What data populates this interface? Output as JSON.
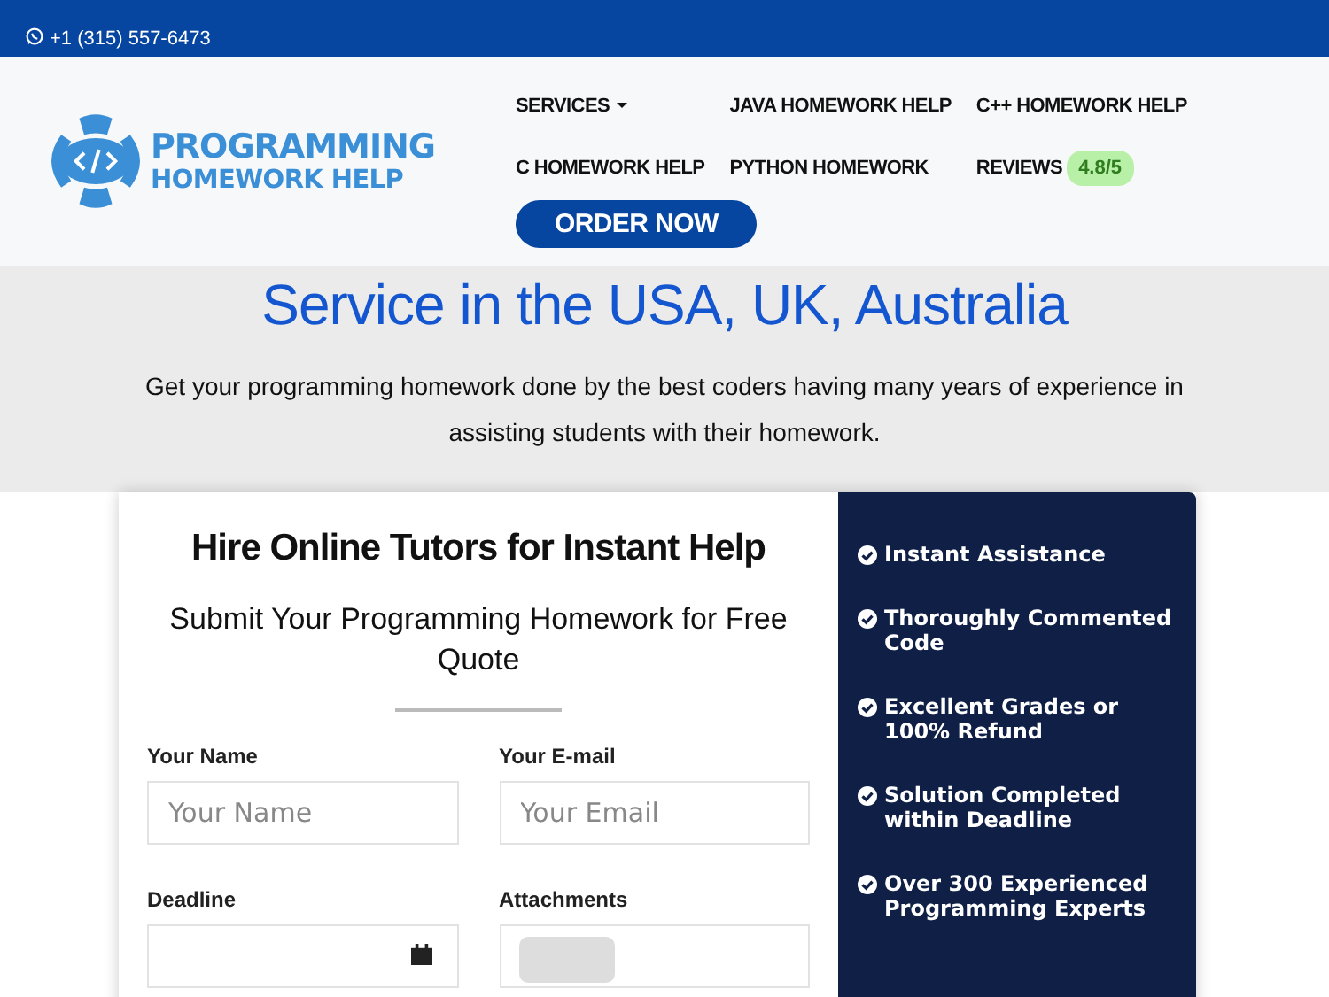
{
  "top_bar": {
    "phone": "+1 (315) 557-6473"
  },
  "logo": {
    "line_1": "PROGRAMMING",
    "line_2": "HOMEWORK HELP"
  },
  "nav": {
    "items": [
      {
        "label": "SERVICES",
        "kind": "dropdown"
      },
      {
        "label": "JAVA HOMEWORK HELP",
        "kind": "link"
      },
      {
        "label": "C++ HOMEWORK HELP",
        "kind": "link"
      },
      {
        "label": "C HOMEWORK HELP",
        "kind": "link"
      },
      {
        "label": "PYTHON HOMEWORK",
        "kind": "link"
      },
      {
        "label": "REVIEWS",
        "kind": "rating",
        "badge": "4.8/5"
      }
    ],
    "cta": "ORDER NOW"
  },
  "hero": {
    "title": "Service in the USA, UK, Australia",
    "subtitle": "Get your programming homework done by the best coders having many years of experience in assisting students with their homework."
  },
  "form": {
    "title": "Hire Online Tutors for Instant Help",
    "subtitle": "Submit Your Programming Homework for Free Quote",
    "fields": [
      {
        "label": "Your Name",
        "kind": "text",
        "placeholder": "Your Name"
      },
      {
        "label": "Your E-mail",
        "kind": "text",
        "placeholder": "Your Email"
      },
      {
        "label": "Deadline",
        "kind": "date"
      },
      {
        "label": "Attachments",
        "kind": "file"
      }
    ]
  },
  "features": [
    "Instant Assistance",
    "Thoroughly Commented Code",
    "Excellent Grades or 100% Refund",
    "Solution Completed within Deadline",
    "Over 300 Experienced Programming Experts"
  ]
}
